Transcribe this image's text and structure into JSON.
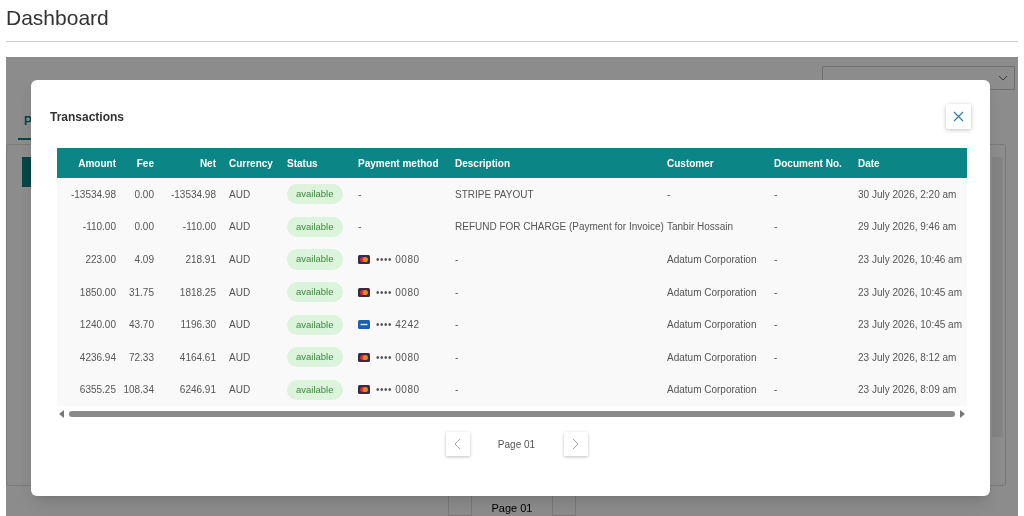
{
  "page": {
    "title": "Dashboard"
  },
  "background": {
    "tab_label": "P",
    "pagination": "Page 01"
  },
  "modal": {
    "title": "Transactions",
    "columns": [
      "Amount",
      "Fee",
      "Net",
      "Currency",
      "Status",
      "Payment method",
      "Description",
      "Customer",
      "Document No.",
      "Date"
    ],
    "rows": [
      {
        "amount": "-13534.98",
        "fee": "0.00",
        "net": "-13534.98",
        "currency": "AUD",
        "status": "available",
        "payment": {
          "kind": "none",
          "text": "-"
        },
        "description": "STRIPE PAYOUT",
        "customer": "-",
        "document": "-",
        "date": "30 July 2026, 2:20 am"
      },
      {
        "amount": "-110.00",
        "fee": "0.00",
        "net": "-110.00",
        "currency": "AUD",
        "status": "available",
        "payment": {
          "kind": "none",
          "text": "-"
        },
        "description": "REFUND FOR CHARGE (Payment for Invoice)",
        "customer": "Tanbir Hossain",
        "document": "-",
        "date": "29 July 2026, 9:46 am"
      },
      {
        "amount": "223.00",
        "fee": "4.09",
        "net": "218.91",
        "currency": "AUD",
        "status": "available",
        "payment": {
          "kind": "mastercard",
          "text": "•••• 0080"
        },
        "description": "-",
        "customer": "Adatum Corporation",
        "document": "-",
        "date": "23 July 2026, 10:46 am"
      },
      {
        "amount": "1850.00",
        "fee": "31.75",
        "net": "1818.25",
        "currency": "AUD",
        "status": "available",
        "payment": {
          "kind": "mastercard",
          "text": "•••• 0080"
        },
        "description": "-",
        "customer": "Adatum Corporation",
        "document": "-",
        "date": "23 July 2026, 10:45 am"
      },
      {
        "amount": "1240.00",
        "fee": "43.70",
        "net": "1196.30",
        "currency": "AUD",
        "status": "available",
        "payment": {
          "kind": "visa",
          "text": "•••• 4242"
        },
        "description": "-",
        "customer": "Adatum Corporation",
        "document": "-",
        "date": "23 July 2026, 10:45 am"
      },
      {
        "amount": "4236.94",
        "fee": "72.33",
        "net": "4164.61",
        "currency": "AUD",
        "status": "available",
        "payment": {
          "kind": "mastercard",
          "text": "•••• 0080"
        },
        "description": "-",
        "customer": "Adatum Corporation",
        "document": "-",
        "date": "23 July 2026, 8:12 am"
      },
      {
        "amount": "6355.25",
        "fee": "108.34",
        "net": "6246.91",
        "currency": "AUD",
        "status": "available",
        "payment": {
          "kind": "mastercard",
          "text": "•••• 0080"
        },
        "description": "-",
        "customer": "Adatum Corporation",
        "document": "-",
        "date": "23 July 2026, 8:09 am"
      }
    ],
    "pagination": "Page 01"
  }
}
